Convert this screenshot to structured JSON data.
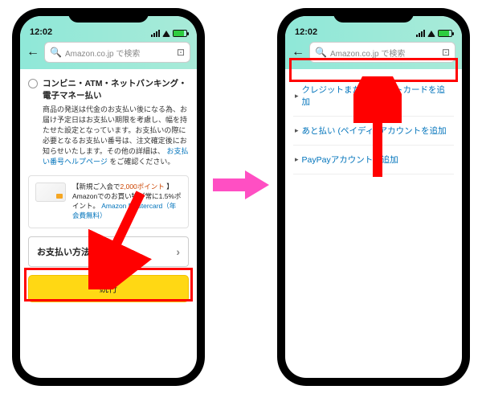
{
  "statusbar": {
    "time": "12:02"
  },
  "search": {
    "placeholder": "Amazon.co.jp で検索"
  },
  "left_screen": {
    "payment_title": "コンビニ・ATM・ネットバンキング・電子マネー払い",
    "payment_desc_1": "商品の発送は代金のお支払い後になる為、お届け予定日はお支払い期限を考慮し、幅を持たせた設定となっています。お支払いの際に必要となるお支払い番号は、注文確定後にお知らせいたします。その他の詳細は、",
    "payment_link": "お支払い番号ヘルプページ",
    "payment_desc_2": "をご確認ください。",
    "promo_line1_a": "【新規ご入会で",
    "promo_line1_b": "2,000ポイント",
    "promo_line2": "】Amazonでのお買い物が常に1.5%ポイント。",
    "promo_link": "Amazon Mastercard（年会費無料）",
    "add_payment": "お支払い方法を追加",
    "continue": "続行"
  },
  "right_screen": {
    "options": [
      "クレジットまたはデビットカードを追加",
      "あと払い (ペイディ) アカウントを追加",
      "PayPayアカウントを追加"
    ]
  }
}
